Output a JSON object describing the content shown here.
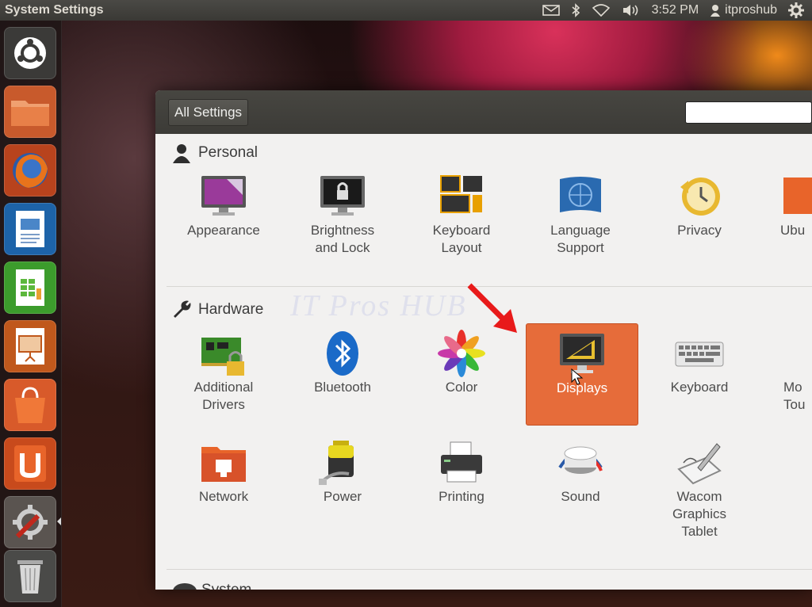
{
  "top_panel": {
    "title": "System Settings",
    "time": "3:52 PM",
    "user": "itproshub",
    "icons": [
      "mail-icon",
      "bluetooth-icon",
      "wifi-icon",
      "volume-icon",
      "user-icon",
      "gear-icon"
    ]
  },
  "launcher": {
    "items": [
      "ubuntu-dash-icon",
      "files-icon",
      "firefox-icon",
      "writer-icon",
      "calc-icon",
      "impress-icon",
      "software-center-icon",
      "ubuntu-one-icon",
      "system-settings-icon",
      "trash-icon"
    ]
  },
  "window": {
    "all_settings_label": "All Settings",
    "search_placeholder": "",
    "watermark": "IT Pros HUB",
    "sections": {
      "personal": {
        "title": "Personal",
        "items": [
          "Appearance",
          "Brightness\nand Lock",
          "Keyboard\nLayout",
          "Language\nSupport",
          "Privacy",
          "Ubu"
        ]
      },
      "hardware": {
        "title": "Hardware",
        "items": [
          "Additional\nDrivers",
          "Bluetooth",
          "Color",
          "Displays",
          "Keyboard",
          "Mo\nTou",
          "Network",
          "Power",
          "Printing",
          "Sound",
          "Wacom\nGraphics\nTablet"
        ]
      },
      "system": {
        "title": "System"
      }
    },
    "selected_item": "Displays",
    "accent_color": "#e66c3a"
  }
}
